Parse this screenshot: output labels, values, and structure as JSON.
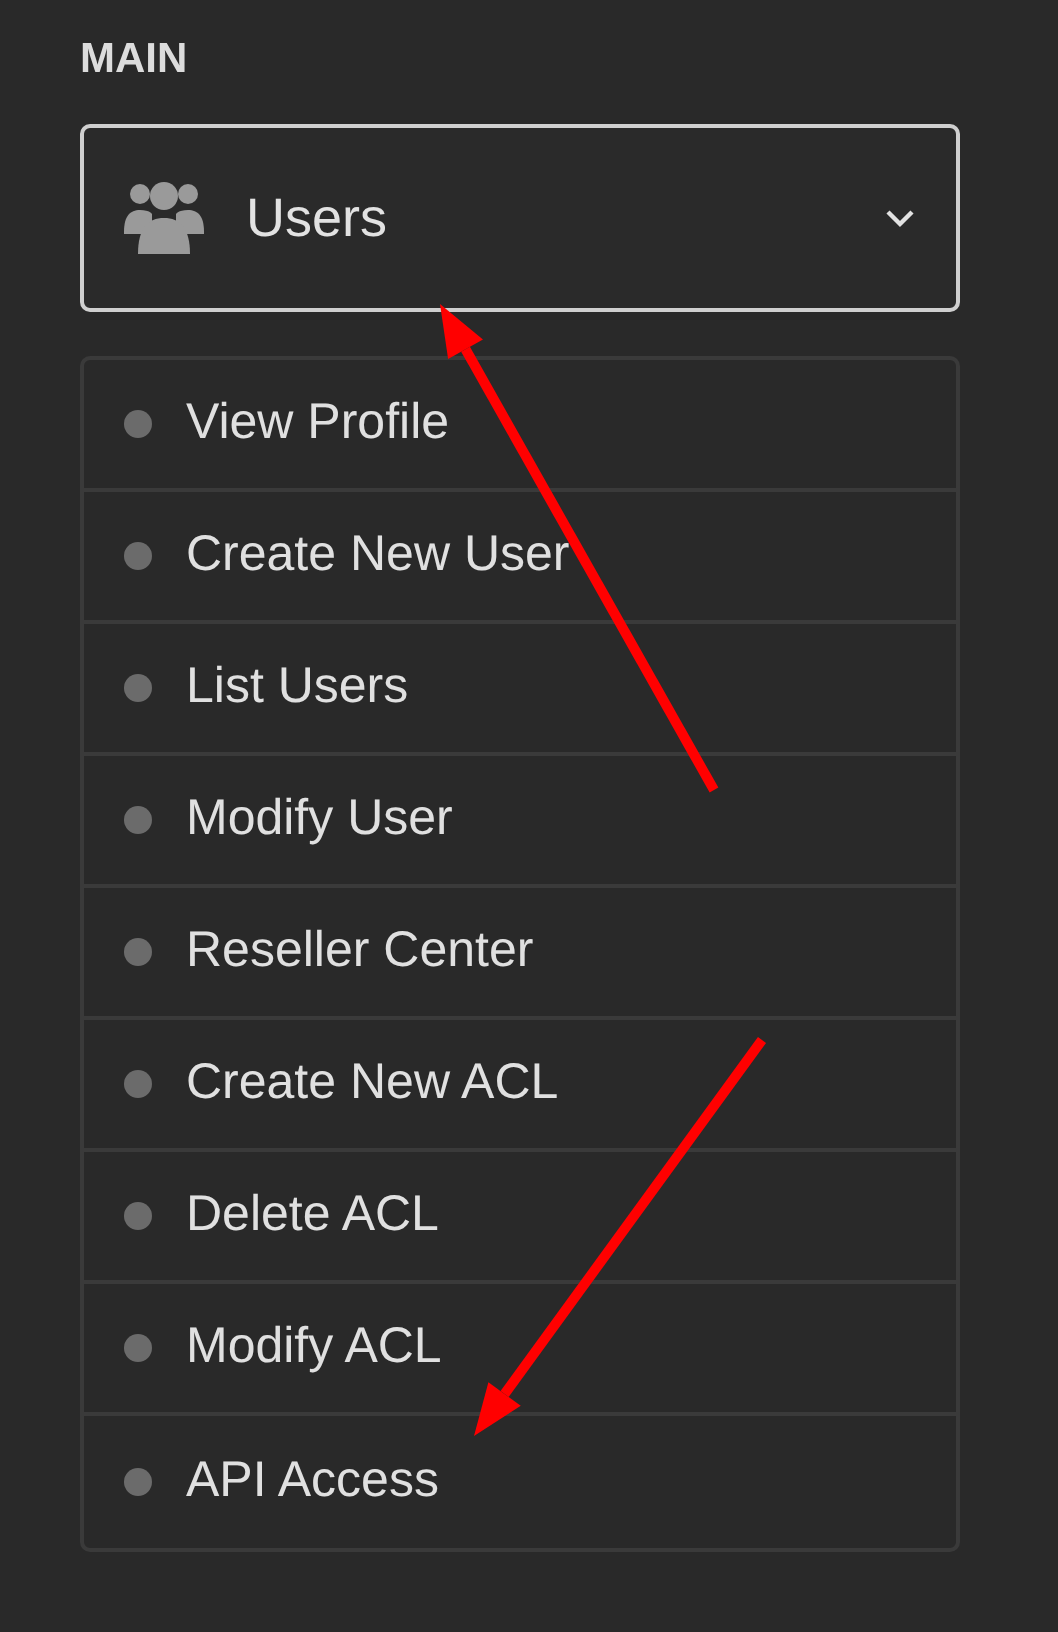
{
  "section_title": "MAIN",
  "menu": {
    "label": "Users",
    "expanded": true,
    "items": [
      {
        "label": "View Profile"
      },
      {
        "label": "Create New User"
      },
      {
        "label": "List Users"
      },
      {
        "label": "Modify User"
      },
      {
        "label": "Reseller Center"
      },
      {
        "label": "Create New ACL"
      },
      {
        "label": "Delete ACL"
      },
      {
        "label": "Modify ACL"
      },
      {
        "label": "API Access"
      }
    ]
  },
  "annotations": [
    {
      "kind": "arrow"
    },
    {
      "kind": "arrow"
    }
  ]
}
